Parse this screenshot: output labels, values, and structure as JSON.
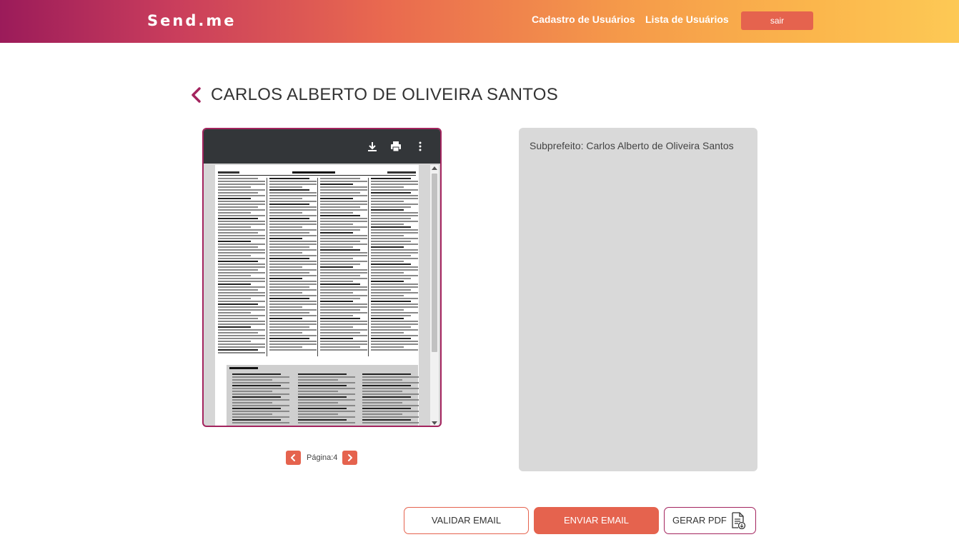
{
  "header": {
    "brand": "Send.me",
    "nav": {
      "cadastro": "Cadastro de Usuários",
      "lista": "Lista de Usuários"
    },
    "logout_label": "sair"
  },
  "page": {
    "title": "CARLOS ALBERTO DE OLIVEIRA SANTOS"
  },
  "viewer": {
    "icons": [
      "download-icon",
      "print-icon",
      "more-vert-icon"
    ]
  },
  "pagination": {
    "label": "Página:4"
  },
  "info": {
    "subprefeito": "Subprefeito: Carlos Alberto de Oliveira Santos"
  },
  "actions": {
    "validar": "VALIDAR EMAIL",
    "enviar": "ENVIAR EMAIL",
    "gerar": "GERAR PDF"
  },
  "colors": {
    "accent": "#e5634e",
    "brand_dark": "#a3245e",
    "panel": "#d9d9d9"
  }
}
